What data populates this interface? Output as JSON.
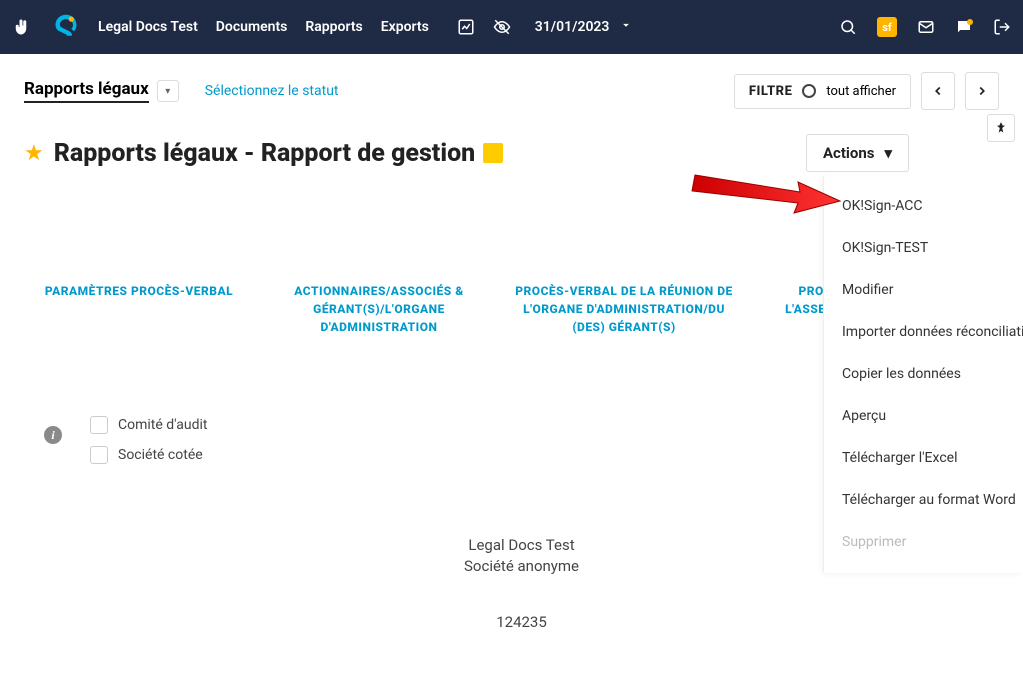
{
  "nav": {
    "brand": "Legal Docs Test",
    "items": [
      "Documents",
      "Rapports",
      "Exports"
    ],
    "date": "31/01/2023",
    "sf_badge": "sf"
  },
  "filter": {
    "label": "FILTRE",
    "text": "tout afficher"
  },
  "breadcrumb": {
    "title": "Rapports légaux",
    "status_link": "Sélectionnez le statut"
  },
  "page": {
    "title": "Rapports légaux - Rapport de gestion",
    "actions_label": "Actions"
  },
  "tabs": [
    "PARAMÈTRES PROCÈS-VERBAL",
    "ACTIONNAIRES/ASSOCIÉS & GÉRANT(S)/L'ORGANE D'ADMINISTRATION",
    "PROCÈS-VERBAL DE LA RÉUNION DE L'ORGANE D'ADMINISTRATION/DU (DES) GÉRANT(S)",
    "PROCÈS-VERBAL DE L'ASSEMBLÉE GÉNÉRALE ORDINAIRE"
  ],
  "checkboxes": {
    "audit": "Comité d'audit",
    "listed": "Société cotée"
  },
  "company": {
    "name": "Legal Docs Test",
    "type": "Société anonyme",
    "id": "124235"
  },
  "actions_menu": [
    {
      "label": "OK!Sign-ACC",
      "disabled": false
    },
    {
      "label": "OK!Sign-TEST",
      "disabled": false
    },
    {
      "label": "Modifier",
      "disabled": false
    },
    {
      "label": "Importer données réconciliation",
      "disabled": false
    },
    {
      "label": "Copier les données",
      "disabled": false
    },
    {
      "label": "Aperçu",
      "disabled": false
    },
    {
      "label": "Télécharger l'Excel",
      "disabled": false
    },
    {
      "label": "Télécharger au format Word",
      "disabled": false
    },
    {
      "label": "Supprimer",
      "disabled": true
    }
  ]
}
